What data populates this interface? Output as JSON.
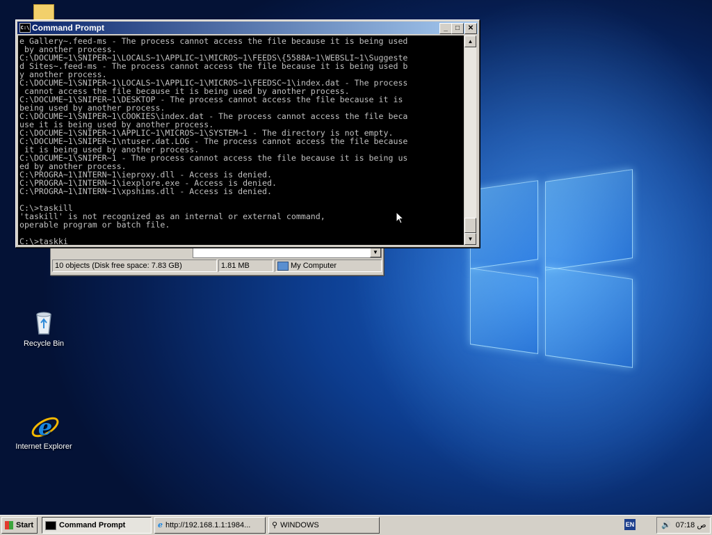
{
  "desktop": {
    "icons": [
      {
        "label": "Recycle Bin",
        "icon": "recycle-bin-icon"
      },
      {
        "label": "Internet Explorer",
        "icon": "internet-explorer-icon"
      }
    ]
  },
  "explorer": {
    "status_objects": "10 objects (Disk free space: 7.83 GB)",
    "status_size": "1.81 MB",
    "status_location": "My Computer"
  },
  "cmd": {
    "title": "Command Prompt",
    "icon_text": "C:\\",
    "minimize": "_",
    "maximize": "□",
    "close": "✕",
    "output": "e Gallery~.feed-ms - The process cannot access the file because it is being used\n by another process.\nC:\\DOCUME~1\\SNIPER~1\\LOCALS~1\\APPLIC~1\\MICROS~1\\FEEDS\\{5588A~1\\WEBSLI~1\\Suggeste\nd Sites~.feed-ms - The process cannot access the file because it is being used b\ny another process.\nC:\\DOCUME~1\\SNIPER~1\\LOCALS~1\\APPLIC~1\\MICROS~1\\FEEDSC~1\\index.dat - The process\n cannot access the file because it is being used by another process.\nC:\\DOCUME~1\\SNIPER~1\\DESKTOP - The process cannot access the file because it is\nbeing used by another process.\nC:\\DOCUME~1\\SNIPER~1\\COOKIES\\index.dat - The process cannot access the file beca\nuse it is being used by another process.\nC:\\DOCUME~1\\SNIPER~1\\APPLIC~1\\MICROS~1\\SYSTEM~1 - The directory is not empty.\nC:\\DOCUME~1\\SNIPER~1\\ntuser.dat.LOG - The process cannot access the file because\n it is being used by another process.\nC:\\DOCUME~1\\SNIPER~1 - The process cannot access the file because it is being us\ned by another process.\nC:\\PROGRA~1\\INTERN~1\\ieproxy.dll - Access is denied.\nC:\\PROGRA~1\\INTERN~1\\iexplore.exe - Access is denied.\nC:\\PROGRA~1\\INTERN~1\\xpshims.dll - Access is denied.\n\nC:\\>taskill\n'taskill' is not recognized as an internal or external command,\noperable program or batch file.\n\nC:\\>taskki"
  },
  "taskbar": {
    "start_label": "Start",
    "buttons": [
      {
        "label": "Command Prompt",
        "icon": "cmd-icon",
        "active": true
      },
      {
        "label": "http://192.168.1.1:1984...",
        "icon": "ie-icon",
        "active": false
      },
      {
        "label": "WINDOWS",
        "icon": "search-icon",
        "active": false
      }
    ],
    "lang": "EN",
    "clock": "07:18 ص"
  }
}
